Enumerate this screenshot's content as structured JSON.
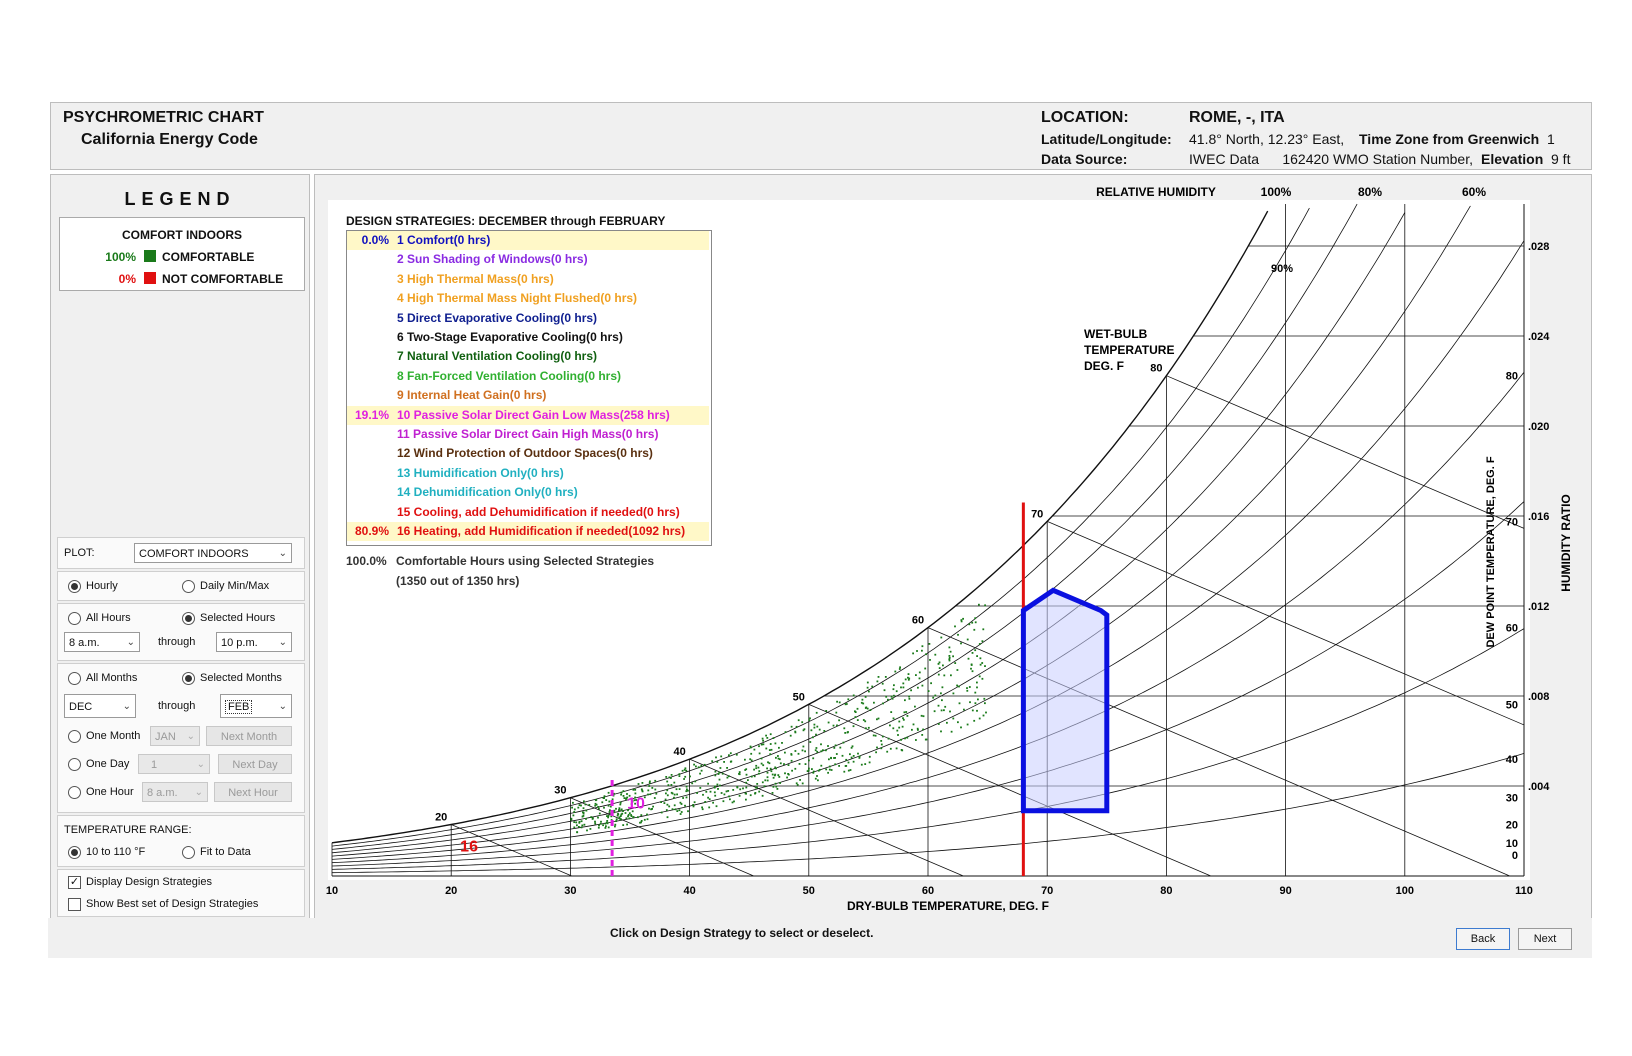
{
  "header": {
    "title1": "PSYCHROMETRIC  CHART",
    "title2": "California Energy Code",
    "location_label": "LOCATION:",
    "location_value": "ROME, -, ITA",
    "latlon_label": "Latitude/Longitude:",
    "latlon_value": "41.8° North, 12.23° East,",
    "tz_label": "Time Zone from Greenwich",
    "tz_value": "1",
    "source_label": "Data Source:",
    "source_value": "IWEC Data      162420 WMO Station Number,",
    "elev_label": "Elevation",
    "elev_value": "9 ft"
  },
  "legend": {
    "title": "LEGEND",
    "heading": "COMFORT INDOORS",
    "items": [
      {
        "pct": "100%",
        "label": "COMFORTABLE",
        "color": "#1a7a1a",
        "pct_color": "#1a7a1a"
      },
      {
        "pct": "0%",
        "label": "NOT COMFORTABLE",
        "color": "#e01010",
        "pct_color": "#e01010"
      }
    ]
  },
  "controls": {
    "plot_label": "PLOT:",
    "plot_value": "COMFORT INDOORS",
    "hourly": "Hourly",
    "daily": "Daily Min/Max",
    "all_hours": "All Hours",
    "selected_hours": "Selected Hours",
    "hour_from": "8 a.m.",
    "through1": "through",
    "hour_to": "10 p.m.",
    "all_months": "All Months",
    "selected_months": "Selected Months",
    "month_from": "DEC",
    "through2": "through",
    "month_to": "FEB",
    "one_month": "One Month",
    "one_month_value": "JAN",
    "next_month": "Next Month",
    "one_day": "One Day",
    "one_day_value": "1",
    "next_day": "Next Day",
    "one_hour": "One Hour",
    "one_hour_value": "8 a.m.",
    "next_hour": "Next Hour",
    "temp_range_label": "TEMPERATURE RANGE:",
    "temp_range_a": "10 to 110 °F",
    "temp_range_b": "Fit to Data",
    "display_strategies": "Display Design Strategies",
    "show_best": "Show Best set of Design Strategies"
  },
  "strategies": {
    "title": "DESIGN STRATEGIES:  DECEMBER through FEBRUARY",
    "items": [
      {
        "pct": "0.0%",
        "text": "1  Comfort(0 hrs)",
        "color": "#1010c0",
        "highlight": true
      },
      {
        "pct": "",
        "text": "2  Sun Shading of Windows(0 hrs)",
        "color": "#8a2be2",
        "highlight": false
      },
      {
        "pct": "",
        "text": "3  High Thermal Mass(0 hrs)",
        "color": "#f0a020",
        "highlight": false
      },
      {
        "pct": "",
        "text": "4  High Thermal Mass Night Flushed(0 hrs)",
        "color": "#f0a020",
        "highlight": false
      },
      {
        "pct": "",
        "text": "5  Direct Evaporative Cooling(0 hrs)",
        "color": "#102090",
        "highlight": false
      },
      {
        "pct": "",
        "text": "6  Two-Stage Evaporative Cooling(0 hrs)",
        "color": "#111111",
        "highlight": false
      },
      {
        "pct": "",
        "text": "7  Natural Ventilation Cooling(0 hrs)",
        "color": "#106010",
        "highlight": false
      },
      {
        "pct": "",
        "text": "8  Fan-Forced Ventilation Cooling(0 hrs)",
        "color": "#30b030",
        "highlight": false
      },
      {
        "pct": "",
        "text": "9  Internal Heat Gain(0 hrs)",
        "color": "#d07020",
        "highlight": false
      },
      {
        "pct": "19.1%",
        "text": "10  Passive Solar Direct Gain Low Mass(258 hrs)",
        "color": "#e020e0",
        "highlight": true
      },
      {
        "pct": "",
        "text": "11  Passive Solar Direct Gain High Mass(0 hrs)",
        "color": "#c020d0",
        "highlight": false
      },
      {
        "pct": "",
        "text": "12  Wind Protection of Outdoor Spaces(0 hrs)",
        "color": "#5a3010",
        "highlight": false
      },
      {
        "pct": "",
        "text": "13  Humidification Only(0 hrs)",
        "color": "#20b0c0",
        "highlight": false
      },
      {
        "pct": "",
        "text": "14  Dehumidification Only(0 hrs)",
        "color": "#20b0c0",
        "highlight": false
      },
      {
        "pct": "",
        "text": "15  Cooling, add Dehumidification if needed(0 hrs)",
        "color": "#e01010",
        "highlight": false
      },
      {
        "pct": "80.9%",
        "text": "16  Heating, add Humidification if needed(1092 hrs)",
        "color": "#e01010",
        "highlight": true
      }
    ],
    "summary_pct": "100.0%",
    "summary_text": "Comfortable Hours using Selected Strategies",
    "summary_sub": "(1350 out of 1350 hrs)"
  },
  "chart_data": {
    "type": "scatter",
    "xlabel": "DRY-BULB TEMPERATURE, DEG. F",
    "ylabel_right": "HUMIDITY RATIO",
    "ylabel_dew": "DEW POINT TEMPERATURE, DEG. F",
    "rh_label": "RELATIVE HUMIDITY",
    "rh_top_labels": [
      "100%",
      "80%",
      "60%"
    ],
    "rh_inner_label": "90%",
    "wetbulb_label": [
      "WET-BULB",
      "TEMPERATURE",
      "DEG. F"
    ],
    "xlim": [
      10,
      110
    ],
    "x_ticks": [
      10,
      20,
      30,
      40,
      50,
      60,
      70,
      80,
      90,
      100,
      110
    ],
    "ylim": [
      0,
      0.03
    ],
    "w_ticks": [
      ".004",
      ".008",
      ".012",
      ".016",
      ".020",
      ".024",
      ".028"
    ],
    "w_values": [
      0.004,
      0.008,
      0.012,
      0.016,
      0.02,
      0.024,
      0.028
    ],
    "dew_ticks": [
      0,
      10,
      20,
      30,
      40,
      50,
      60,
      70,
      80
    ],
    "wb_labels": [
      20,
      30,
      40,
      50,
      60,
      70,
      80
    ],
    "rh_curves": [
      0.1,
      0.2,
      0.3,
      0.4,
      0.5,
      0.6,
      0.7,
      0.8,
      0.9,
      1.0
    ],
    "comfort_zone": [
      [
        68,
        0.0029
      ],
      [
        68,
        0.0118
      ],
      [
        70.5,
        0.0127
      ],
      [
        74.5,
        0.0118
      ],
      [
        75,
        0.0116
      ],
      [
        75,
        0.0029
      ]
    ],
    "heating_line_x": 68,
    "heating_label": "16",
    "passive_line_x": 33.5,
    "passive_label": "10",
    "scatter_summary": {
      "count": 1350,
      "db_range": [
        30,
        65
      ],
      "rh_range": [
        0.55,
        0.95
      ]
    }
  },
  "footer": {
    "hint": "Click on Design Strategy to select or deselect.",
    "back": "Back",
    "next": "Next"
  }
}
